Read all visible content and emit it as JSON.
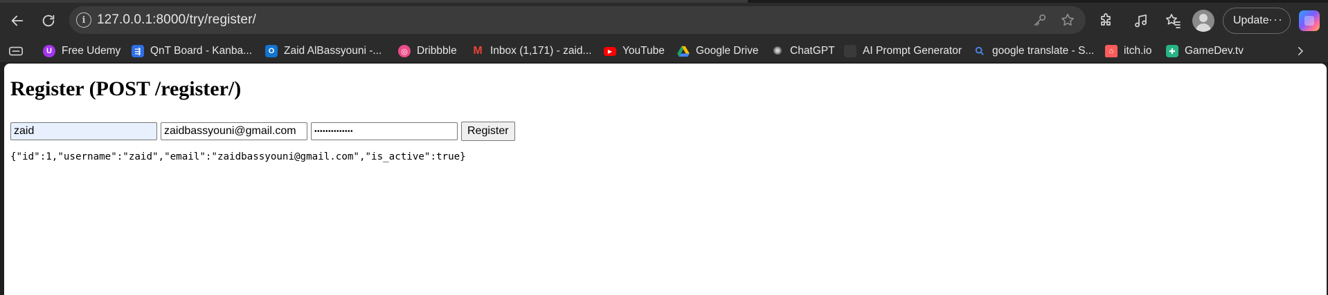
{
  "browser": {
    "url": "127.0.0.1:8000/try/register/",
    "update_label": "Update",
    "update_more": "···"
  },
  "bookmarks": [
    {
      "label": "Free Udemy",
      "icon": "udemy-icon",
      "color": "#a435f0"
    },
    {
      "label": "QnT Board - Kanba...",
      "icon": "kanban-icon",
      "color": "#2f6fe4"
    },
    {
      "label": "Zaid AlBassyouni -...",
      "icon": "outlook-icon",
      "color": "#1374d1"
    },
    {
      "label": "Dribbble",
      "icon": "dribbble-icon",
      "color": "#ea4c89"
    },
    {
      "label": "Inbox (1,171) - zaid...",
      "icon": "gmail-icon",
      "color": "#ea4335"
    },
    {
      "label": "YouTube",
      "icon": "youtube-icon",
      "color": "#ff0000"
    },
    {
      "label": "Google Drive",
      "icon": "google-drive-icon",
      "color": "#1fa463"
    },
    {
      "label": "ChatGPT",
      "icon": "chatgpt-icon",
      "color": "#d0d0d0"
    },
    {
      "label": "AI Prompt Generator",
      "icon": "ai-prompt-icon",
      "color": "#3a3a3a"
    },
    {
      "label": "google translate - S...",
      "icon": "search-icon",
      "color": "#4c8bf5"
    },
    {
      "label": "itch.io",
      "icon": "itchio-icon",
      "color": "#fa5c5c"
    },
    {
      "label": "GameDev.tv",
      "icon": "gamedev-icon",
      "color": "#28b485"
    }
  ],
  "page": {
    "heading": "Register (POST /register/)",
    "username_value": "zaid",
    "email_value": "zaidbassyouni@gmail.com",
    "password_value": "••••••••••••••",
    "submit_label": "Register",
    "result_json": "{\"id\":1,\"username\":\"zaid\",\"email\":\"zaidbassyouni@gmail.com\",\"is_active\":true}"
  }
}
